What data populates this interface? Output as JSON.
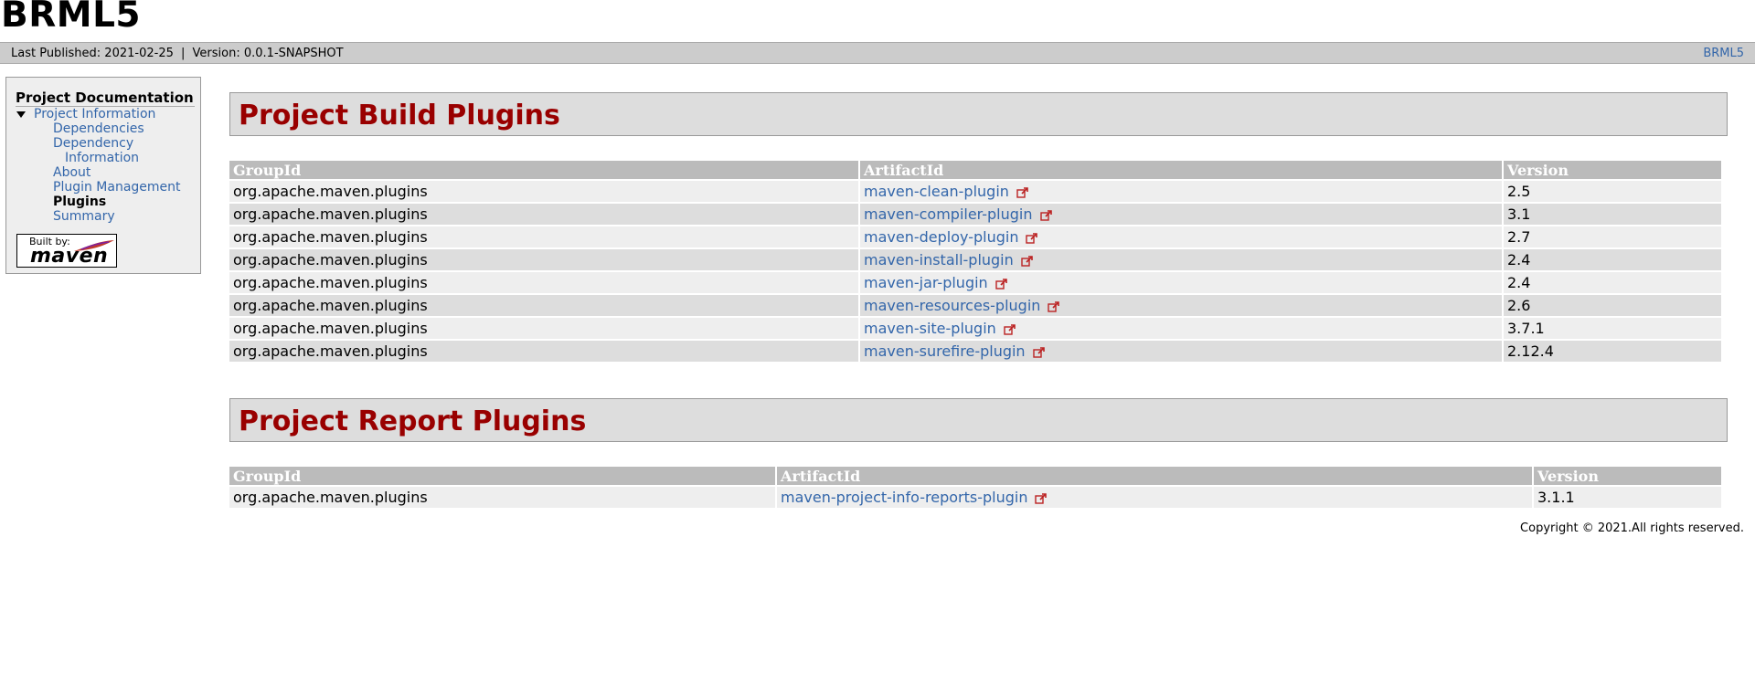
{
  "site": {
    "title": "BRML5"
  },
  "breadcrumbs": {
    "published": "Last Published: 2021-02-25",
    "separator": "|",
    "version": "Version: 0.0.1-SNAPSHOT",
    "right_link": "BRML5"
  },
  "sidebar": {
    "heading": "Project Documentation",
    "items": [
      {
        "label": "Project Information"
      },
      {
        "label": "Dependencies"
      },
      {
        "label": "Dependency"
      },
      {
        "label": "Information"
      },
      {
        "label": "About"
      },
      {
        "label": "Plugin Management"
      },
      {
        "label": "Plugins"
      },
      {
        "label": "Summary"
      }
    ],
    "powered_by": {
      "built_by": "Built by:",
      "logo_text": "maven"
    }
  },
  "build_section": {
    "title": "Project Build Plugins",
    "headers": [
      "GroupId",
      "ArtifactId",
      "Version"
    ],
    "rows": [
      {
        "group": "org.apache.maven.plugins",
        "artifact": "maven-clean-plugin",
        "version": "2.5"
      },
      {
        "group": "org.apache.maven.plugins",
        "artifact": "maven-compiler-plugin",
        "version": "3.1"
      },
      {
        "group": "org.apache.maven.plugins",
        "artifact": "maven-deploy-plugin",
        "version": "2.7"
      },
      {
        "group": "org.apache.maven.plugins",
        "artifact": "maven-install-plugin",
        "version": "2.4"
      },
      {
        "group": "org.apache.maven.plugins",
        "artifact": "maven-jar-plugin",
        "version": "2.4"
      },
      {
        "group": "org.apache.maven.plugins",
        "artifact": "maven-resources-plugin",
        "version": "2.6"
      },
      {
        "group": "org.apache.maven.plugins",
        "artifact": "maven-site-plugin",
        "version": "3.7.1"
      },
      {
        "group": "org.apache.maven.plugins",
        "artifact": "maven-surefire-plugin",
        "version": "2.12.4"
      }
    ]
  },
  "report_section": {
    "title": "Project Report Plugins",
    "headers": [
      "GroupId",
      "ArtifactId",
      "Version"
    ],
    "rows": [
      {
        "group": "org.apache.maven.plugins",
        "artifact": "maven-project-info-reports-plugin",
        "version": "3.1.1"
      }
    ]
  },
  "footer": {
    "copyright": "Copyright © 2021.All rights reserved."
  },
  "colors": {
    "link": "#3366aa",
    "heading": "#990000",
    "table_header": "#bbbbbb"
  },
  "icons": {
    "external_link": "external-link-icon",
    "expand": "triangle-down-icon"
  }
}
